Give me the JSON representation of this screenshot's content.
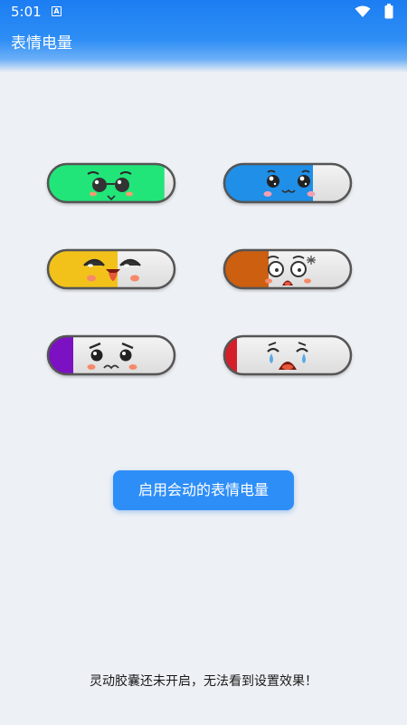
{
  "status_bar": {
    "time": "5:01",
    "notification_glyph": "A",
    "icons": [
      "wifi-icon",
      "battery-icon"
    ]
  },
  "app": {
    "title": "表情电量"
  },
  "capsules": [
    {
      "id": "glasses",
      "fill_color": "#22e57a",
      "level": 0.92,
      "expression": "cool-with-sunglasses"
    },
    {
      "id": "happy",
      "fill_color": "#1f8fe8",
      "level": 0.7,
      "expression": "sparkly-eyes-smile"
    },
    {
      "id": "tongue",
      "fill_color": "#f2c21b",
      "level": 0.55,
      "expression": "laughing-tongue-out"
    },
    {
      "id": "shocked",
      "fill_color": "#cc5f10",
      "level": 0.35,
      "expression": "shocked-angry"
    },
    {
      "id": "sad",
      "fill_color": "#7b11c2",
      "level": 0.2,
      "expression": "sad-worried"
    },
    {
      "id": "crying",
      "fill_color": "#d41f2b",
      "level": 0.1,
      "expression": "crying"
    }
  ],
  "actions": {
    "enable_label": "启用会动的表情电量"
  },
  "footer": {
    "notice": "灵动胶囊还未开启，无法看到设置效果！"
  },
  "colors": {
    "primary": "#2e8ef7",
    "background": "#edf0f4"
  }
}
